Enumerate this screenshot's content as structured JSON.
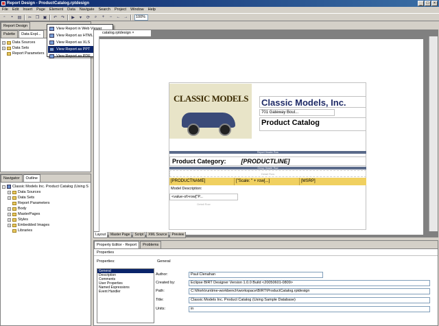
{
  "window": {
    "title": "Report Design - ProductCatalog.rptdesign"
  },
  "menu": [
    "File",
    "Edit",
    "Insert",
    "Page",
    "Element",
    "Data",
    "Navigate",
    "Search",
    "Project",
    "Window",
    "Help"
  ],
  "toolbar": {
    "zoom": "100%"
  },
  "left_tabs": [
    "Report Design",
    "Palette",
    "Data Expl..."
  ],
  "data_tree": [
    "Data Sources",
    "Data Sets",
    "Report Parameters"
  ],
  "preview_menu": [
    "View Report in Web Viewer",
    "View Report as HTML",
    "View Report as XLS",
    "View Report as PPT",
    "View Report as PDF"
  ],
  "editor": {
    "tab": "catalog.rptdesign"
  },
  "report": {
    "logo_text": "CLASSIC MODELS",
    "company": "Classic Models, Inc.",
    "address": "701 Gateway Boul...",
    "catalog": "Product Catalog",
    "header_band": "Report Header Row",
    "group_band": "Group Header Row",
    "category_label": "Product Category:",
    "category_value": "[PRODUCTLINE]",
    "detail_row_label": "Detail Row",
    "detail": [
      "[PRODUCTNAME]",
      "[\"Scale: \" + row[...]",
      "[MSRP]"
    ],
    "model_desc_label": "Model Description:",
    "value_of": "<value-of>row[\"P...",
    "detail_row2": "Detail Row"
  },
  "bottom_tabs": [
    "Layout",
    "Master Page",
    "Script",
    "XML Source",
    "Preview"
  ],
  "outline": {
    "tabs": [
      "Navigator",
      "Outline"
    ],
    "root": "Classic Models Inc. Product Catalog (Using S",
    "items": [
      "Data Sources",
      "Data Sets",
      "Report Parameters",
      "Body",
      "MasterPages",
      "Styles",
      "Embedded Images",
      "Libraries"
    ]
  },
  "props": {
    "tabs": [
      "Property Editor - Report",
      "Problems"
    ],
    "subtab": "Properties",
    "list_header": "Properties:",
    "general_header": "General",
    "list": [
      "General",
      "Description",
      "Comments",
      "User Properties",
      "Named Expressions",
      "Event Handler"
    ],
    "fields": [
      {
        "label": "Author:",
        "value": "Paul Clenahan"
      },
      {
        "label": "Created by:",
        "value": "Eclipse BIRT Designer Version 1.0.0 Build <20050601-0809>"
      },
      {
        "label": "Path:",
        "value": "C:\\Work\\runtime-workbench\\workspace\\BIRT\\ProductCatalog.rptdesign"
      },
      {
        "label": "Title:",
        "value": "Classic Models Inc. Product Catalog (Using Sample Database)"
      },
      {
        "label": "Units:",
        "value": "in"
      }
    ]
  }
}
